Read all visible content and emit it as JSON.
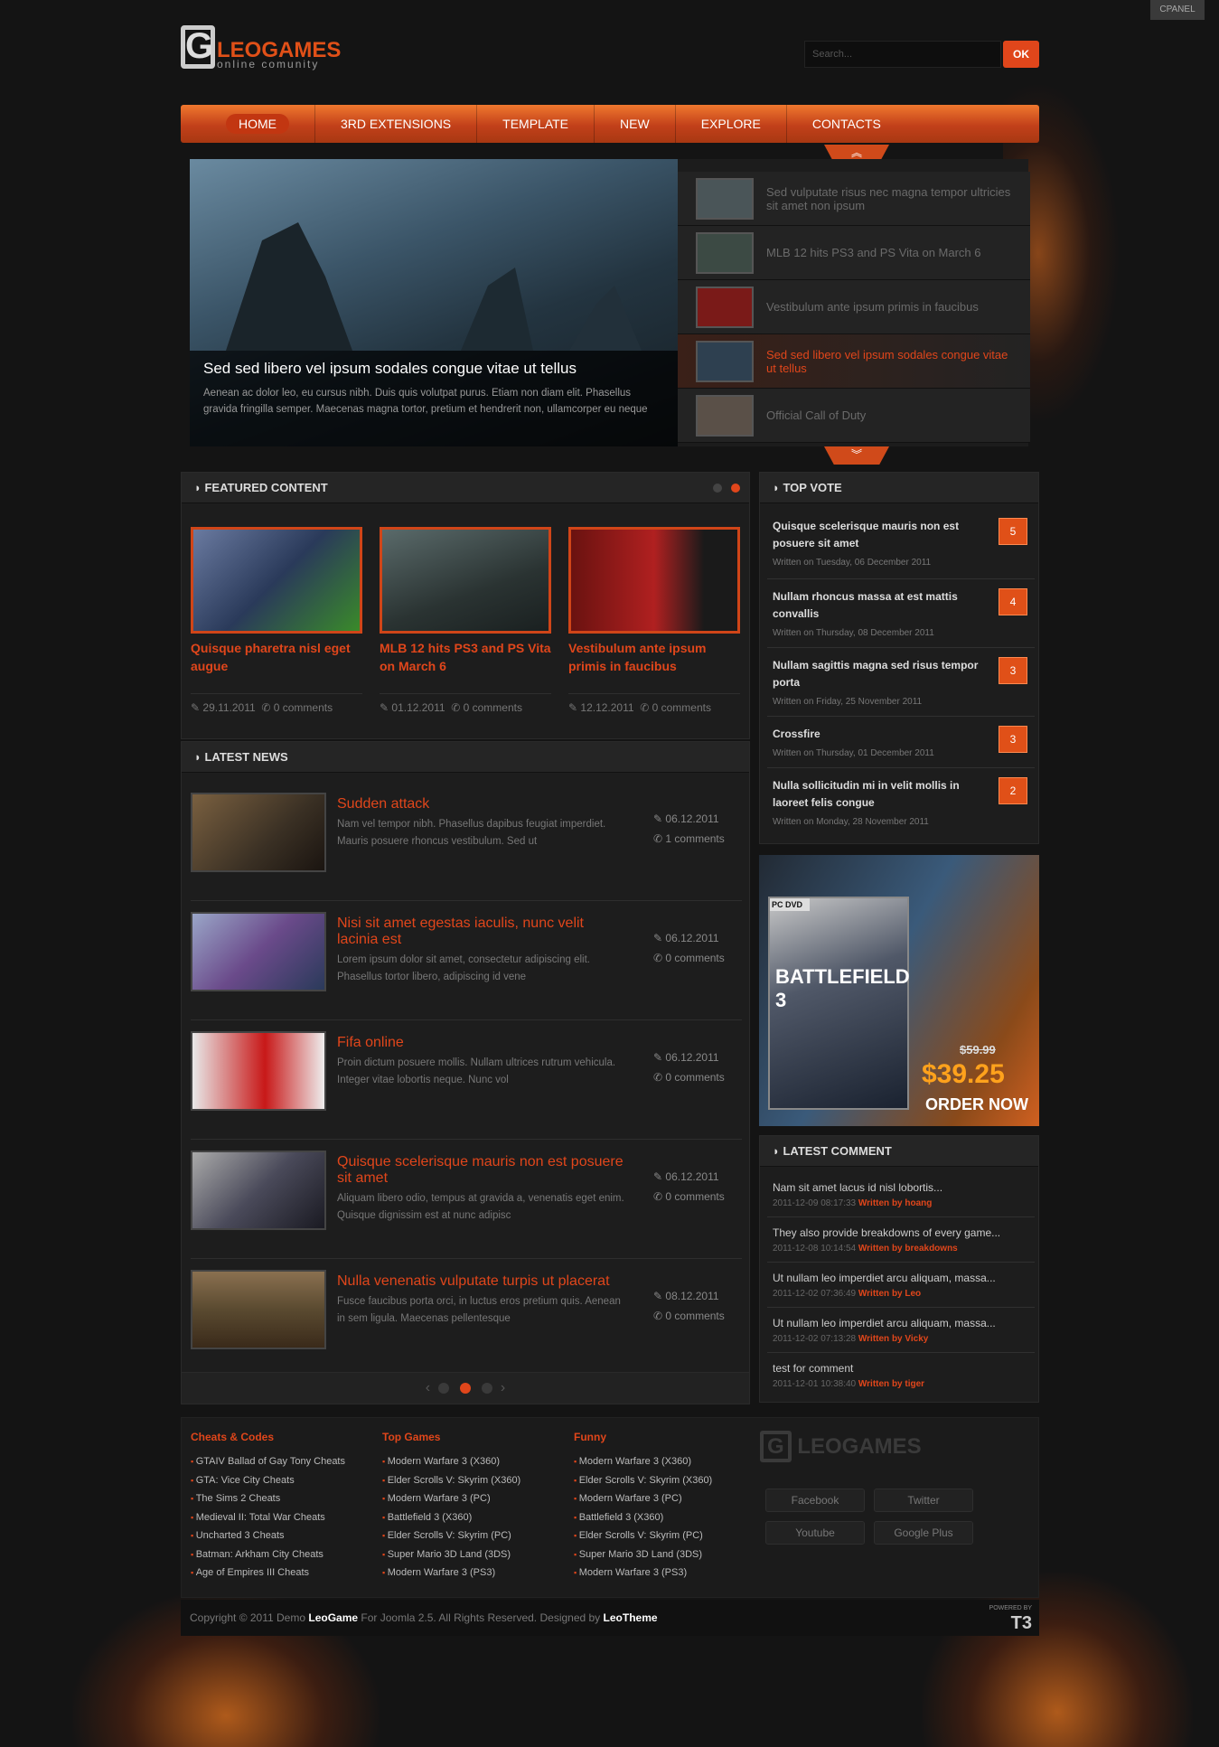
{
  "cpanel": "CPANEL",
  "logo": {
    "big": "LEOGAMES",
    "small": "online comunity"
  },
  "search": {
    "placeholder": "Search...",
    "button": "OK"
  },
  "nav": [
    "HOME",
    "3RD EXTENSIONS",
    "TEMPLATE",
    "NEW",
    "EXPLORE",
    "CONTACTS"
  ],
  "slideshow": {
    "title": "Sed sed libero vel ipsum sodales congue vitae ut tellus",
    "desc": "Aenean ac dolor leo, eu cursus nibh. Duis quis volutpat purus. Etiam non diam elit. Phasellus gravida fringilla semper. Maecenas magna tortor, pretium et hendrerit non, ullamcorper eu neque",
    "thumbs": [
      "Sed vulputate risus nec magna tempor ultricies sit amet non ipsum",
      "MLB 12 hits PS3 and PS Vita on March 6",
      "Vestibulum ante ipsum primis in faucibus",
      "Sed sed libero vel ipsum sodales congue vitae ut tellus",
      "Official Call of Duty"
    ]
  },
  "featured": {
    "heading": "FEATURED CONTENT",
    "items": [
      {
        "title": "Quisque pharetra nisl eget augue",
        "date": "29.11.2011",
        "comments": "0 comments"
      },
      {
        "title": "MLB 12 hits PS3 and PS Vita on March 6",
        "date": "01.12.2011",
        "comments": "0 comments"
      },
      {
        "title": "Vestibulum ante ipsum primis in faucibus",
        "date": "12.12.2011",
        "comments": "0 comments"
      }
    ]
  },
  "news": {
    "heading": "LATEST NEWS",
    "items": [
      {
        "title": "Sudden attack",
        "desc": "Nam vel tempor nibh. Phasellus dapibus feugiat imperdiet. Mauris posuere rhoncus vestibulum. Sed ut",
        "date": "06.12.2011",
        "comments": "1 comments"
      },
      {
        "title": "Nisi sit amet egestas iaculis, nunc velit lacinia est",
        "desc": "Lorem ipsum dolor sit amet, consectetur adipiscing elit. Phasellus tortor libero, adipiscing id vene",
        "date": "06.12.2011",
        "comments": "0 comments"
      },
      {
        "title": "Fifa online",
        "desc": "Proin dictum posuere mollis. Nullam ultrices rutrum vehicula. Integer vitae lobortis neque. Nunc vol",
        "date": "06.12.2011",
        "comments": "0 comments"
      },
      {
        "title": "Quisque scelerisque mauris non est posuere sit amet",
        "desc": "Aliquam libero odio, tempus at gravida a, venenatis eget enim. Quisque dignissim est at nunc adipisc",
        "date": "06.12.2011",
        "comments": "0 comments"
      },
      {
        "title": "Nulla venenatis vulputate turpis ut placerat",
        "desc": "Fusce faucibus porta orci, in luctus eros pretium quis. Aenean in sem ligula. Maecenas pellentesque",
        "date": "08.12.2011",
        "comments": "0 comments"
      }
    ]
  },
  "topvote": {
    "heading": "TOP VOTE",
    "items": [
      {
        "title": "Quisque scelerisque mauris non est posuere sit amet",
        "date": "Written on Tuesday, 06 December 2011",
        "votes": "5"
      },
      {
        "title": "Nullam rhoncus massa at est mattis convallis",
        "date": "Written on Thursday, 08 December 2011",
        "votes": "4"
      },
      {
        "title": "Nullam sagittis magna sed risus tempor porta",
        "date": "Written on Friday, 25 November 2011",
        "votes": "3"
      },
      {
        "title": "Crossfire",
        "date": "Written on Thursday, 01 December 2011",
        "votes": "3"
      },
      {
        "title": "Nulla sollicitudin mi in velit mollis in laoreet felis congue",
        "date": "Written on Monday, 28 November 2011",
        "votes": "2"
      }
    ]
  },
  "ad": {
    "game": "BATTLEFIELD 3",
    "old_price": "$59.99",
    "price": "$39.25",
    "cta": "ORDER NOW",
    "platform": "PC DVD"
  },
  "comments": {
    "heading": "LATEST COMMENT",
    "items": [
      {
        "text": "Nam sit amet lacus id nisl lobortis...",
        "date": "2011-12-09 08:17:33",
        "by": "Written by hoang"
      },
      {
        "text": "They also provide breakdowns of every game...",
        "date": "2011-12-08 10:14:54",
        "by": "Written by breakdowns"
      },
      {
        "text": "Ut nullam leo imperdiet arcu aliquam, massa...",
        "date": "2011-12-02 07:36:49",
        "by": "Written by Leo"
      },
      {
        "text": "Ut nullam leo imperdiet arcu aliquam, massa...",
        "date": "2011-12-02 07:13:28",
        "by": "Written by Vicky"
      },
      {
        "text": "test for comment",
        "date": "2011-12-01 10:38:40",
        "by": "Written by tiger"
      }
    ]
  },
  "footer": {
    "cols": [
      {
        "title": "Cheats & Codes",
        "links": [
          "GTAIV Ballad of Gay Tony Cheats",
          "GTA: Vice City Cheats",
          "The Sims 2 Cheats",
          "Medieval II: Total War Cheats",
          "Uncharted 3 Cheats",
          "Batman: Arkham City Cheats",
          "Age of Empires III Cheats"
        ]
      },
      {
        "title": "Top Games",
        "links": [
          "Modern Warfare 3 (X360)",
          "Elder Scrolls V: Skyrim (X360)",
          "Modern Warfare 3 (PC)",
          "Battlefield 3 (X360)",
          "Elder Scrolls V: Skyrim (PC)",
          "Super Mario 3D Land (3DS)",
          "Modern Warfare 3 (PS3)"
        ]
      },
      {
        "title": "Funny",
        "links": [
          "Modern Warfare 3 (X360)",
          "Elder Scrolls V: Skyrim (X360)",
          "Modern Warfare 3 (PC)",
          "Battlefield 3 (X360)",
          "Elder Scrolls V: Skyrim (PC)",
          "Super Mario 3D Land (3DS)",
          "Modern Warfare 3 (PS3)"
        ]
      }
    ],
    "social": [
      "Facebook",
      "Twitter",
      "Youtube",
      "Google Plus"
    ],
    "copyright_pre": "Copyright © 2011 Demo",
    "brand": "LeoGame",
    "copyright_mid": "For Joomla 2.5. All Rights Reserved. Designed by",
    "designer": "LeoTheme",
    "powered": "POWERED BY",
    "t3": "T3"
  }
}
